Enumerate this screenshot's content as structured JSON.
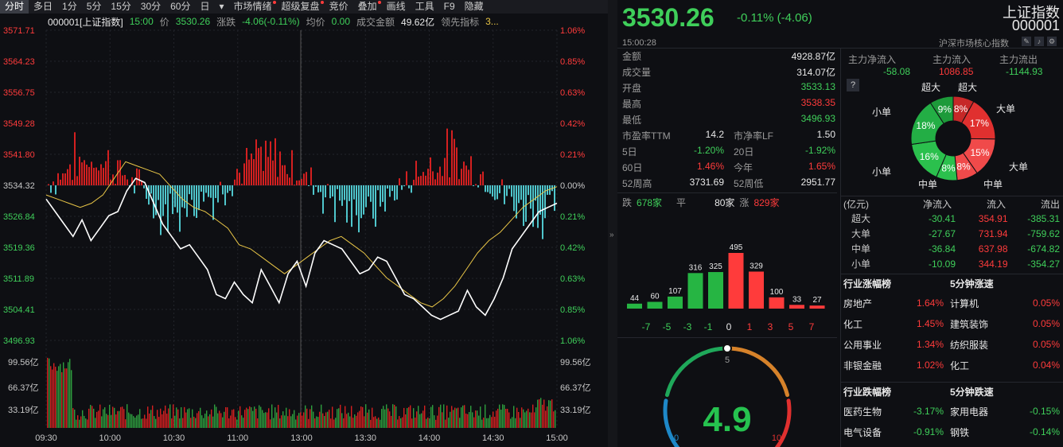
{
  "toolbar": {
    "items": [
      "分时",
      "多日",
      "1分",
      "5分",
      "15分",
      "30分",
      "60分",
      "日",
      "▾",
      "市场情绪",
      "超级复盘",
      "竞价",
      "叠加",
      "画线",
      "工具",
      "F9",
      "隐藏"
    ],
    "active_index": 0
  },
  "info": {
    "code": "000001[上证指数]",
    "time": "15:00",
    "price_label": "价",
    "price": "3530.26",
    "change_label": "涨跌",
    "change": "-4.06(-0.11%)",
    "avg_label": "均价",
    "avg": "0.00",
    "amount_label": "成交金额",
    "amount": "49.62亿",
    "lead_label": "领先指标",
    "lead": "3..."
  },
  "chart_data": {
    "type": "line",
    "prev_close": 3534.32,
    "y_left_ticks": [
      "3571.71",
      "3564.23",
      "3556.75",
      "3549.28",
      "3541.80",
      "3534.32",
      "3526.84",
      "3519.36",
      "3511.89",
      "3504.41",
      "3496.93"
    ],
    "y_right_ticks": [
      "1.06%",
      "0.85%",
      "0.63%",
      "0.42%",
      "0.21%",
      "0.00%",
      "0.21%",
      "0.42%",
      "0.63%",
      "0.85%",
      "1.06%"
    ],
    "vol_ticks_left": [
      "99.56亿",
      "66.37亿",
      "33.19亿"
    ],
    "vol_ticks_right": [
      "99.56亿",
      "66.37亿",
      "33.19亿"
    ],
    "x_ticks": [
      "09:30",
      "10:00",
      "10:30",
      "11:00",
      "13:00",
      "13:30",
      "14:00",
      "14:30",
      "15:00"
    ],
    "series": [
      {
        "values": [
          3531,
          3528,
          3525,
          3522,
          3526,
          3521,
          3524,
          3527,
          3528,
          3533,
          3536,
          3535,
          3530,
          3525,
          3522,
          3519,
          3520,
          3517,
          3514,
          3508,
          3507,
          3511,
          3508,
          3506,
          3514,
          3510,
          3506,
          3513,
          3516,
          3510,
          3518,
          3521,
          3520,
          3519,
          3516,
          3513,
          3514,
          3517,
          3516,
          3512,
          3508,
          3507,
          3505,
          3503,
          3502,
          3503,
          3504,
          3509,
          3505,
          3503,
          3507,
          3512,
          3519,
          3522,
          3525,
          3528,
          3529,
          3530
        ]
      },
      {
        "values": [
          3532,
          3531,
          3530,
          3529,
          3530,
          3532,
          3536,
          3540,
          3539,
          3538,
          3537,
          3534,
          3531,
          3529,
          3528,
          3526,
          3524,
          3520,
          3519,
          3517,
          3515,
          3513,
          3515,
          3517,
          3519,
          3521,
          3522,
          3520,
          3518,
          3515,
          3512,
          3510,
          3508,
          3506,
          3505,
          3507,
          3510,
          3514,
          3518,
          3521,
          3523,
          3526,
          3529,
          3531,
          3533,
          3534
        ]
      }
    ]
  },
  "right": {
    "price": "3530.26",
    "change": "-0.11% (-4.06)",
    "name": "上证指数",
    "code": "000001",
    "time": "15:00:28",
    "core_label": "沪深市场核心指数",
    "stats": [
      {
        "label": "金额",
        "value": "4928.87亿",
        "color": "white"
      },
      {
        "label": "成交量",
        "value": "314.07亿",
        "color": "white"
      },
      {
        "label": "开盘",
        "value": "3533.13",
        "color": "green"
      },
      {
        "label": "最高",
        "value": "3538.35",
        "color": "red"
      },
      {
        "label": "最低",
        "value": "3496.93",
        "color": "green"
      }
    ],
    "stats2": [
      {
        "l1": "市盈率TTM",
        "v1": "14.2",
        "c1": "white",
        "l2": "市净率LF",
        "v2": "1.50",
        "c2": "white"
      },
      {
        "l1": "5日",
        "v1": "-1.20%",
        "c1": "green",
        "l2": "20日",
        "v2": "-1.92%",
        "c2": "green"
      },
      {
        "l1": "60日",
        "v1": "1.46%",
        "c1": "red",
        "l2": "今年",
        "v2": "1.65%",
        "c2": "red"
      },
      {
        "l1": "52周高",
        "v1": "3731.69",
        "c1": "white",
        "l2": "52周低",
        "v2": "2951.77",
        "c2": "white"
      }
    ],
    "breadth": {
      "down_label": "跌",
      "down": "678家",
      "flat_label": "平",
      "flat": "80家",
      "up_label": "涨",
      "up": "829家"
    },
    "dist": {
      "labels": [
        "-7",
        "-5",
        "-3",
        "-1",
        "0",
        "1",
        "3",
        "5",
        "7"
      ],
      "values": [
        44,
        60,
        107,
        316,
        325,
        495,
        329,
        100,
        33,
        27
      ]
    },
    "gauge": {
      "value": "4.9",
      "min": "0",
      "mid": "5",
      "max": "10"
    },
    "flow": {
      "net_label": "主力净流入",
      "net": "-58.08",
      "in_label": "主力流入",
      "in": "1086.85",
      "out_label": "主力流出",
      "out": "-1144.93",
      "help": "?"
    },
    "donut": {
      "labels": [
        "超大",
        "超大",
        "大单",
        "大单",
        "中单",
        "中单",
        "小单",
        "小单"
      ],
      "values": [
        "9%",
        "8%",
        "17%",
        "15%",
        "8%",
        "8%",
        "16%",
        "18%"
      ]
    },
    "flow_table": {
      "headers": [
        "(亿元)",
        "净流入",
        "流入",
        "流出"
      ],
      "rows": [
        [
          "超大",
          "-30.41",
          "354.91",
          "-385.31"
        ],
        [
          "大单",
          "-27.67",
          "731.94",
          "-759.62"
        ],
        [
          "中单",
          "-36.84",
          "637.98",
          "-674.82"
        ],
        [
          "小单",
          "-10.09",
          "344.19",
          "-354.27"
        ]
      ]
    },
    "sector_up": {
      "title": "行业涨幅榜",
      "title2": "5分钟涨速",
      "rows": [
        [
          "房地产",
          "1.64%",
          "计算机",
          "0.05%"
        ],
        [
          "化工",
          "1.45%",
          "建筑装饰",
          "0.05%"
        ],
        [
          "公用事业",
          "1.34%",
          "纺织服装",
          "0.05%"
        ],
        [
          "非银金融",
          "1.02%",
          "化工",
          "0.04%"
        ]
      ]
    },
    "sector_down": {
      "title": "行业跌幅榜",
      "title2": "5分钟跌速",
      "rows": [
        [
          "医药生物",
          "-3.17%",
          "家用电器",
          "-0.15%"
        ],
        [
          "电气设备",
          "-0.91%",
          "钢铁",
          "-0.14%"
        ]
      ]
    }
  }
}
